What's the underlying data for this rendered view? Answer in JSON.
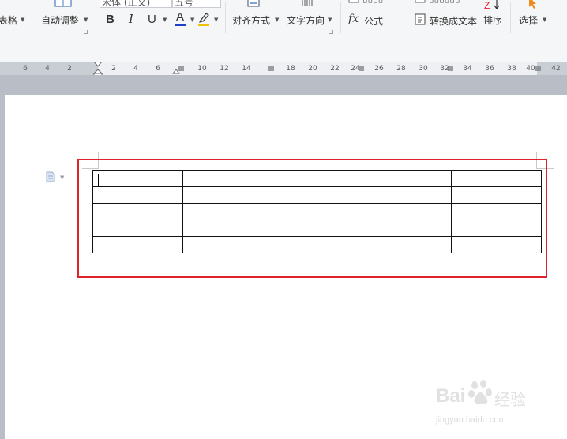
{
  "toolbar": {
    "table_label": "表格",
    "autofit_label": "自动调整",
    "font_name": "宋体 (正文)",
    "font_size": "五号",
    "bold": "B",
    "italic": "I",
    "underline": "U",
    "font_color_letter": "A",
    "align_label": "对齐方式",
    "text_direction_label": "文字方向",
    "formula_label": "公式",
    "formula_symbol": "fx",
    "convert_text_label": "转换成文本",
    "sort_label": "排序",
    "select_label": "选择",
    "accent_colors": {
      "font_color": "#1f3fc8",
      "highlight": "#f2c20a",
      "select_arrow": "#f08a1c"
    }
  },
  "ruler": {
    "left_numbers": [
      "6",
      "4",
      "2",
      "2",
      "4",
      "6"
    ],
    "right_numbers": [
      "10",
      "12",
      "14",
      "18",
      "20",
      "22",
      "24",
      "26",
      "28",
      "30",
      "32",
      "34",
      "36",
      "38",
      "40",
      "42"
    ]
  },
  "document": {
    "table": {
      "rows": 5,
      "cols": 5
    },
    "paragraph_icon": "document-icon",
    "highlight_color": "#e0222a"
  },
  "watermark": {
    "brand": "Bai",
    "brand_suffix": "经验",
    "url": "jingyan.baidu.com"
  }
}
